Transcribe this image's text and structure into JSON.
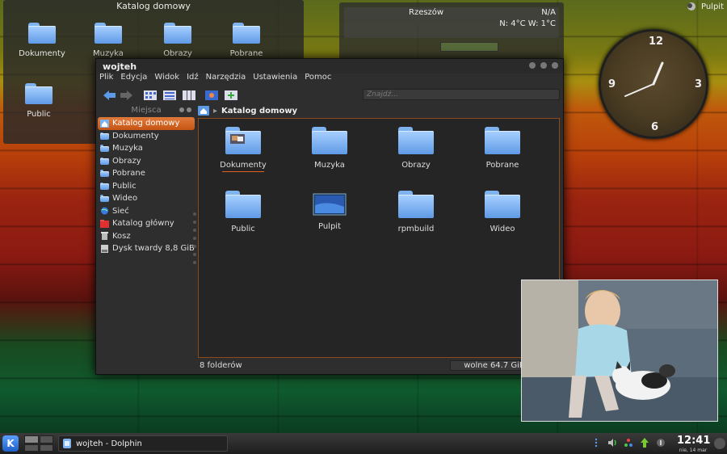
{
  "desktop_folder": {
    "title": "Katalog domowy",
    "items": [
      "Dokumenty",
      "Muzyka",
      "Obrazy",
      "Pobrane",
      "Public"
    ]
  },
  "weather": {
    "city": "Rzeszów",
    "condition": "N/A",
    "temp": "N: 4°C W: 1°C"
  },
  "pulpit_toolbox": {
    "label": "Pulpit"
  },
  "clock": {
    "numbers": {
      "twelve": "12",
      "three": "3",
      "six": "6",
      "nine": "9"
    }
  },
  "window": {
    "title": "wojteh",
    "menu": [
      "Plik",
      "Edycja",
      "Widok",
      "Idź",
      "Narzędzia",
      "Ustawienia",
      "Pomoc"
    ],
    "search_placeholder": "Znajdź...",
    "places_header": "Miejsca",
    "places": [
      "Katalog domowy",
      "Dokumenty",
      "Muzyka",
      "Obrazy",
      "Pobrane",
      "Public",
      "Wideo",
      "Sieć",
      "Katalog główny",
      "Kosz",
      "Dysk twardy 8,8 GiB"
    ],
    "breadcrumb": "Katalog domowy",
    "items": [
      "Dokumenty",
      "Muzyka",
      "Obrazy",
      "Pobrane",
      "Public",
      "Pulpit",
      "rpmbuild",
      "Wideo"
    ],
    "status_count": "8 folderów",
    "status_free": "wolne 64.7 GiB"
  },
  "taskbar": {
    "task_label": "wojteh - Dolphin",
    "time": "12:41",
    "date": "nie, 14 mar"
  },
  "colors": {
    "accent": "#d9631e",
    "folder": "#7fb3f0",
    "window_bg": "#2e2e2e"
  }
}
